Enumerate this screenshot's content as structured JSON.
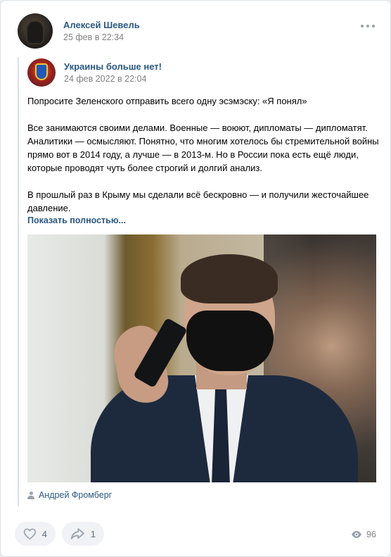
{
  "post": {
    "author": "Алексей Шевель",
    "date": "25 фев в 22:34"
  },
  "repost": {
    "group": "Украины больше нет!",
    "date": "24 фев 2022 в 22:04",
    "paragraphs": [
      "Попросите Зеленского отправить всего одну эсэмэску: «Я понял»",
      "Все занимаются своими делами. Военные — воюют, дипломаты — дипломатят. Аналитики — осмысляют. Понятно, что многим хотелось бы стремительной войны прямо вот в 2014 году, а лучше — в 2013-м. Но в России пока есть ещё люди, которые проводят чуть более строгий и долгий анализ.",
      "В прошлый раз в Крыму мы сделали всё бескровно — и получили жесточайшее давление."
    ],
    "show_more": "Показать полностью...",
    "photo_author": "Андрей Фромберг"
  },
  "actions": {
    "likes": "4",
    "shares": "1",
    "views": "96"
  },
  "colors": {
    "link": "#2a5885",
    "muted": "#828282",
    "button_bg": "#f0f2f5"
  }
}
